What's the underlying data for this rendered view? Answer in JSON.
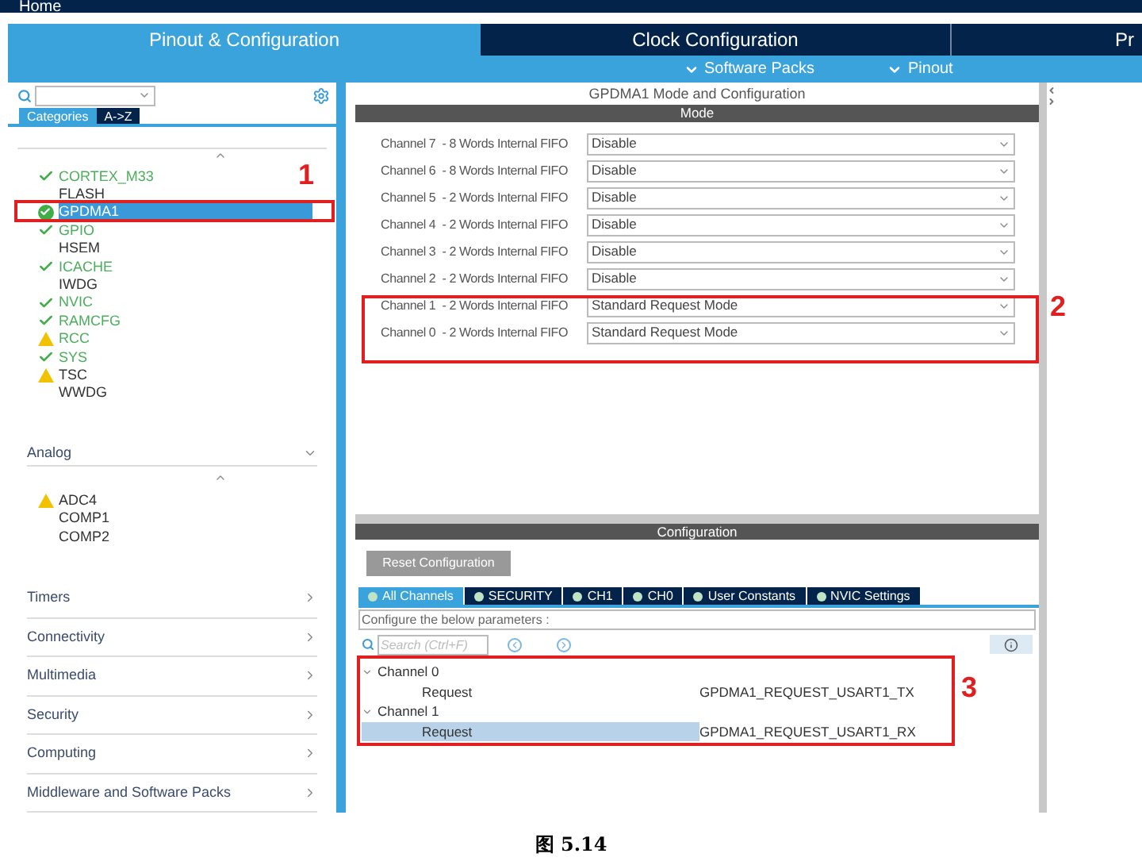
{
  "breadcrumb": [
    "Home"
  ],
  "main_tabs": [
    {
      "label": "Pinout & Configuration",
      "selected": true
    },
    {
      "label": "Clock Configuration",
      "selected": false
    },
    {
      "label": "Pr",
      "selected": false
    }
  ],
  "sub_menu": [
    "Software Packs",
    "Pinout"
  ],
  "sidebar": {
    "view_tabs": [
      {
        "label": "Categories",
        "selected": true
      },
      {
        "label": "A->Z",
        "selected": false
      }
    ],
    "items": [
      {
        "label": "CORTEX_M33",
        "kind": "ok",
        "configured": true,
        "selected": false
      },
      {
        "label": "FLASH",
        "kind": "plain",
        "configured": false,
        "selected": false
      },
      {
        "label": "GPDMA1",
        "kind": "ok",
        "configured": true,
        "selected": true
      },
      {
        "label": "GPIO",
        "kind": "ok",
        "configured": true,
        "selected": false
      },
      {
        "label": "HSEM",
        "kind": "plain",
        "configured": false,
        "selected": false
      },
      {
        "label": "ICACHE",
        "kind": "ok",
        "configured": true,
        "selected": false
      },
      {
        "label": "IWDG",
        "kind": "plain",
        "configured": false,
        "selected": false
      },
      {
        "label": "NVIC",
        "kind": "ok",
        "configured": true,
        "selected": false
      },
      {
        "label": "RAMCFG",
        "kind": "ok",
        "configured": true,
        "selected": false
      },
      {
        "label": "RCC",
        "kind": "warning",
        "configured": true,
        "selected": false
      },
      {
        "label": "SYS",
        "kind": "ok",
        "configured": true,
        "selected": false
      },
      {
        "label": "TSC",
        "kind": "warning",
        "configured": false,
        "selected": false
      },
      {
        "label": "WWDG",
        "kind": "plain",
        "configured": false,
        "selected": false
      }
    ],
    "analog": {
      "label": "Analog",
      "expanded": true,
      "items": [
        {
          "label": "ADC4",
          "kind": "warning"
        },
        {
          "label": "COMP1",
          "kind": "plain"
        },
        {
          "label": "COMP2",
          "kind": "plain"
        }
      ]
    },
    "categories": [
      "Timers",
      "Connectivity",
      "Multimedia",
      "Security",
      "Computing",
      "Middleware and Software Packs"
    ]
  },
  "mode_panel": {
    "title": "GPDMA1 Mode and Configuration",
    "header": "Mode",
    "channels": [
      {
        "label": "Channel 7  - 8 Words Internal FIFO",
        "value": "Disable"
      },
      {
        "label": "Channel 6  - 8 Words Internal FIFO",
        "value": "Disable"
      },
      {
        "label": "Channel 5  - 2 Words Internal FIFO",
        "value": "Disable"
      },
      {
        "label": "Channel 4  - 2 Words Internal FIFO",
        "value": "Disable"
      },
      {
        "label": "Channel 3  - 2 Words Internal FIFO",
        "value": "Disable"
      },
      {
        "label": "Channel 2  - 2 Words Internal FIFO",
        "value": "Disable"
      },
      {
        "label": "Channel 1  - 2 Words Internal FIFO",
        "value": "Standard Request Mode"
      },
      {
        "label": "Channel 0  - 2 Words Internal FIFO",
        "value": "Standard Request Mode"
      }
    ]
  },
  "configuration": {
    "header": "Configuration",
    "reset_button": "Reset Configuration",
    "tabs": [
      {
        "label": "All Channels",
        "selected": true
      },
      {
        "label": "SECURITY",
        "selected": false
      },
      {
        "label": "CH1",
        "selected": false
      },
      {
        "label": "CH0",
        "selected": false
      },
      {
        "label": "User Constants",
        "selected": false
      },
      {
        "label": "NVIC Settings",
        "selected": false
      }
    ],
    "hint": "Configure the below parameters :",
    "search": {
      "placeholder": "Search (Ctrl+F)"
    },
    "tree": [
      {
        "label": "Channel 0",
        "expanded": true,
        "children": [
          {
            "label": "Request",
            "value": "GPDMA1_REQUEST_USART1_TX",
            "selected": false
          }
        ]
      },
      {
        "label": "Channel 1",
        "expanded": true,
        "children": [
          {
            "label": "Request",
            "value": "GPDMA1_REQUEST_USART1_RX",
            "selected": true
          }
        ]
      }
    ]
  },
  "annotations": [
    "1",
    "2",
    "3"
  ],
  "caption": "图 5.14"
}
